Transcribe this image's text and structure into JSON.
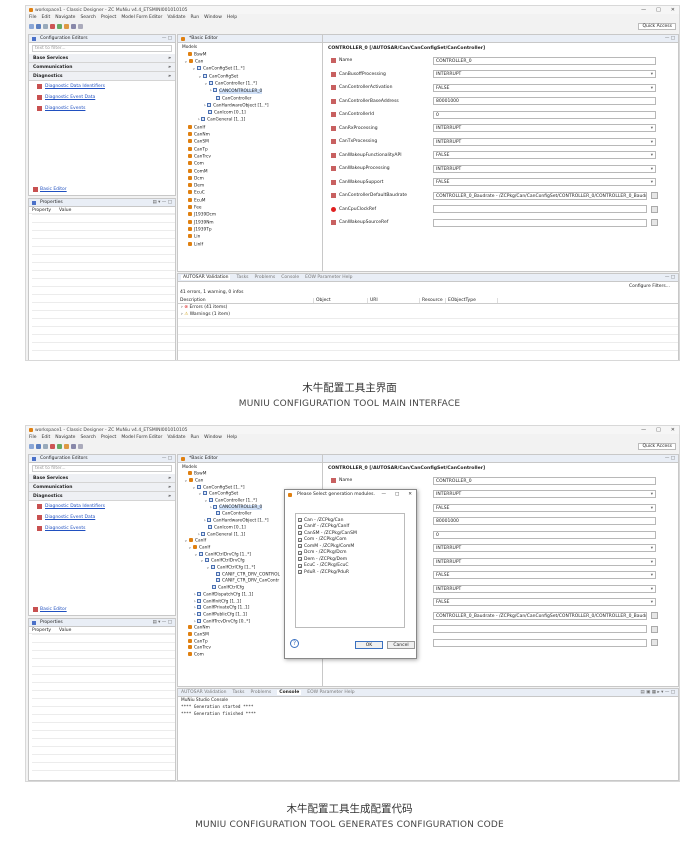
{
  "window": {
    "title": "workspace1 - Classic Designer - ZC MuNiu v4.4_ETSMINI001010105",
    "controls": [
      "—",
      "□",
      "✕"
    ]
  },
  "menu": [
    "File",
    "Edit",
    "Navigate",
    "Search",
    "Project",
    "Model Form Editor",
    "Validate",
    "Run",
    "Window",
    "Help"
  ],
  "quick_access": "Quick Access",
  "config_editors": {
    "title": "Configuration Editors",
    "filter_placeholder": "text to filter...",
    "categories": [
      "Base Services",
      "Communication",
      "Diagnostics"
    ],
    "diag_items": [
      "Diagnostic Data Identifiers",
      "Diagnostic Event Data",
      "Diagnostic Events"
    ],
    "basic_editor_link": "Basic Editor"
  },
  "properties": {
    "title": "Properties",
    "col_property": "Property",
    "col_value": "Value"
  },
  "basic_editor": {
    "tab": "*Basic Editor",
    "models_label": "Models"
  },
  "tree1": [
    "BswM",
    "Can",
    "CanConfigSet [1..*]",
    "CanConfigSet",
    "CanController [1..*]",
    "CANCONTROLLER_0",
    "CanController",
    "CanHardwareObject [1..*]",
    "CanIcom [0..1]",
    "CanGeneral [1..1]",
    "CanIf",
    "CanNm",
    "CanSM",
    "CanTp",
    "CanTrcv",
    "Com",
    "ComM",
    "Dcm",
    "Dem",
    "EcuC",
    "EcuM",
    "Fee",
    "J1939Dcm",
    "J1939Nm",
    "J1939Tp",
    "Lin",
    "LinIf"
  ],
  "form": {
    "title": "CONTROLLER_0 [/AUTOSAR/Can/CanConfigSet/CanController]",
    "rows": [
      {
        "label": "Name",
        "value": "CONTROLLER_0"
      },
      {
        "label": "CanBusoffProcessing",
        "value": "INTERRUPT"
      },
      {
        "label": "CanControllerActivation",
        "value": "FALSE"
      },
      {
        "label": "CanControllerBaseAddress",
        "value": "80001000"
      },
      {
        "label": "CanControllerId",
        "value": "0"
      },
      {
        "label": "CanRxProcessing",
        "value": "INTERRUPT"
      },
      {
        "label": "CanTxProcessing",
        "value": "INTERRUPT"
      },
      {
        "label": "CanWakeupFunctionalityAPI",
        "value": "FALSE"
      },
      {
        "label": "CanWakeupProcessing",
        "value": "INTERRUPT"
      },
      {
        "label": "CanWakeupSupport",
        "value": "FALSE"
      },
      {
        "label": "CanControllerDefaultBaudrate",
        "value": "CONTROLLER_0_Baudrate - /ZCPkg/Can/CanConfigSet/CONTROLLER_0/CONTROLLER_0_Baudrate"
      },
      {
        "label": "CanCpuClockRef",
        "value": ""
      },
      {
        "label": "CanWakeupSourceRef",
        "value": ""
      }
    ]
  },
  "bottom1": {
    "tabs": [
      "AUTOSAR Validation",
      "Tasks",
      "Problems",
      "Console",
      "EOW Parameter Help"
    ],
    "summary": "41 errors, 1 warning, 0 infos",
    "configure_filters": "Configure Filters...",
    "columns": [
      "Description",
      "Object",
      "URI",
      "Resource",
      "EObjectType"
    ],
    "items": [
      "Errors (41 items)",
      "Warnings (1 item)"
    ]
  },
  "caption1": {
    "cn": "木牛配置工具主界面",
    "en": "MUNIU CONFIGURATION TOOL MAIN INTERFACE"
  },
  "tree2": [
    "BswM",
    "Can",
    "CanConfigSet [1..*]",
    "CanConfigSet",
    "CanController [1..*]",
    "CANCONTROLLER_0",
    "CanController",
    "CanHardwareObject [1..*]",
    "CanIcom [0..1]",
    "CanGeneral [1..1]",
    "CanIf",
    "CanIf",
    "CanIfCtrlDrvCfg [1..*]",
    "CanIfCtrlDrvCfg",
    "CanIfCtrlCfg [1..*]",
    "CANIF_CTR_DRV_CONTROL",
    "CANIF_CTR_DRV_CanContr",
    "CanIfCtrlCfg",
    "CanIfDispatchCfg [1..1]",
    "CanIfInitCfg [1..1]",
    "CanIfPrivateCfg [1..1]",
    "CanIfPublicCfg [1..1]",
    "CanIfTrcvDrvCfg [0..*]",
    "CanNm",
    "CanSM",
    "CanTp",
    "CanTrcv",
    "Com"
  ],
  "dialog": {
    "title": "Please Select generation modules.",
    "controls": [
      "—",
      "□",
      "✕"
    ],
    "modules": [
      "Can - /ZCPkg/Can",
      "CanIf - /ZCPkg/CanIf",
      "CanSM - /ZCPkg/CanSM",
      "Com - /ZCPkg/Com",
      "ComM - /ZCPkg/ComM",
      "Dcm - /ZCPkg/Dcm",
      "Dem - /ZCPkg/Dem",
      "EcuC - /ZCPkg/EcuC",
      "PduR - /ZCPkg/PduR"
    ],
    "ok": "OK",
    "cancel": "Cancel",
    "help": "?"
  },
  "form2_values": [
    "CONTROLLER_0",
    "INTERRUPT",
    "FALSE",
    "80001000",
    "0",
    "INTERRUPT",
    "INTERRUPT",
    "FALSE",
    "INTERRUPT",
    "FALSE",
    "CONTROLLER_0_Baudrate - /ZCPkg/Can/CanConfigSet/CONTROLLER_0/CONTROLLER_0_Baudrate",
    "",
    ""
  ],
  "form2_name_label": "Name",
  "console": {
    "title": "MuNiu Studio Console",
    "lines": [
      "**** Generation started ****",
      "**** Generation finished ****"
    ]
  },
  "caption2": {
    "cn": "木牛配置工具生成配置代码",
    "en": "MUNIU CONFIGURATION TOOL GENERATES CONFIGURATION CODE"
  }
}
